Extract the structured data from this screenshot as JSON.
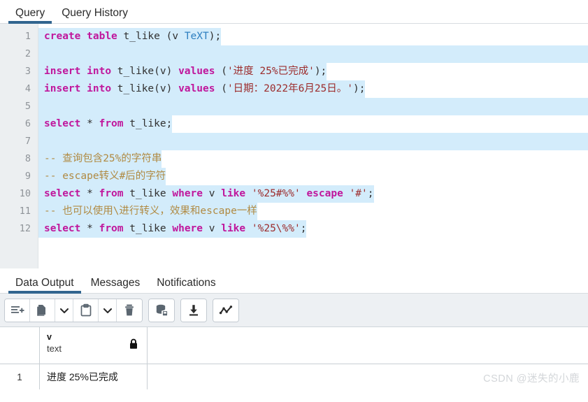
{
  "editor_tabs": [
    {
      "label": "Query",
      "active": true
    },
    {
      "label": "Query History",
      "active": false
    }
  ],
  "editor": {
    "accent_color": "#31658f",
    "selection_color": "#d3ecfb",
    "gutter_bg": "#eceff1",
    "lines": [
      {
        "no": "1",
        "tokens": [
          {
            "t": "create",
            "c": "kw"
          },
          {
            "t": " ",
            "c": "pl"
          },
          {
            "t": "table",
            "c": "kw"
          },
          {
            "t": " t_like (v ",
            "c": "pl"
          },
          {
            "t": "TeXT",
            "c": "typ"
          },
          {
            "t": ");",
            "c": "pl"
          }
        ]
      },
      {
        "no": "2",
        "tokens": []
      },
      {
        "no": "3",
        "tokens": [
          {
            "t": "insert",
            "c": "kw"
          },
          {
            "t": " ",
            "c": "pl"
          },
          {
            "t": "into",
            "c": "kw"
          },
          {
            "t": " t_like(v) ",
            "c": "pl"
          },
          {
            "t": "values",
            "c": "kw"
          },
          {
            "t": " (",
            "c": "pl"
          },
          {
            "t": "'进度 25%已完成'",
            "c": "str"
          },
          {
            "t": ");",
            "c": "pl"
          }
        ]
      },
      {
        "no": "4",
        "tokens": [
          {
            "t": "insert",
            "c": "kw"
          },
          {
            "t": " ",
            "c": "pl"
          },
          {
            "t": "into",
            "c": "kw"
          },
          {
            "t": " t_like(v) ",
            "c": "pl"
          },
          {
            "t": "values",
            "c": "kw"
          },
          {
            "t": " (",
            "c": "pl"
          },
          {
            "t": "'日期：2022年6月25日。'",
            "c": "str"
          },
          {
            "t": ");",
            "c": "pl"
          }
        ]
      },
      {
        "no": "5",
        "tokens": []
      },
      {
        "no": "6",
        "tokens": [
          {
            "t": "select",
            "c": "kw"
          },
          {
            "t": " * ",
            "c": "pl"
          },
          {
            "t": "from",
            "c": "kw"
          },
          {
            "t": " t_like;",
            "c": "pl"
          }
        ]
      },
      {
        "no": "7",
        "tokens": []
      },
      {
        "no": "8",
        "tokens": [
          {
            "t": "-- 查询包含25%的字符串",
            "c": "cmt"
          }
        ]
      },
      {
        "no": "9",
        "tokens": [
          {
            "t": "-- escape转义#后的字符",
            "c": "cmt"
          }
        ]
      },
      {
        "no": "10",
        "tokens": [
          {
            "t": "select",
            "c": "kw"
          },
          {
            "t": " * ",
            "c": "pl"
          },
          {
            "t": "from",
            "c": "kw"
          },
          {
            "t": " t_like ",
            "c": "pl"
          },
          {
            "t": "where",
            "c": "kw"
          },
          {
            "t": " v ",
            "c": "pl"
          },
          {
            "t": "like",
            "c": "kw"
          },
          {
            "t": " ",
            "c": "pl"
          },
          {
            "t": "'%25#%%'",
            "c": "str"
          },
          {
            "t": " ",
            "c": "pl"
          },
          {
            "t": "escape",
            "c": "kw"
          },
          {
            "t": " ",
            "c": "pl"
          },
          {
            "t": "'#'",
            "c": "str"
          },
          {
            "t": ";",
            "c": "pl"
          }
        ]
      },
      {
        "no": "11",
        "tokens": [
          {
            "t": "-- 也可以使用\\进行转义，效果和escape一样",
            "c": "cmt"
          }
        ]
      },
      {
        "no": "12",
        "tokens": [
          {
            "t": "select",
            "c": "kw"
          },
          {
            "t": " * ",
            "c": "pl"
          },
          {
            "t": "from",
            "c": "kw"
          },
          {
            "t": " t_like ",
            "c": "pl"
          },
          {
            "t": "where",
            "c": "kw"
          },
          {
            "t": " v ",
            "c": "pl"
          },
          {
            "t": "like",
            "c": "kw"
          },
          {
            "t": " ",
            "c": "pl"
          },
          {
            "t": "'%25\\%%'",
            "c": "str"
          },
          {
            "t": ";",
            "c": "pl"
          }
        ]
      }
    ]
  },
  "panel_tabs": [
    {
      "label": "Data Output",
      "active": true
    },
    {
      "label": "Messages",
      "active": false
    },
    {
      "label": "Notifications",
      "active": false
    }
  ],
  "toolbar": {
    "groups": [
      {
        "buttons": [
          {
            "icon": "add-row-icon",
            "narrow": false
          },
          {
            "icon": "copy-icon",
            "narrow": false
          },
          {
            "icon": "chevron-down-icon",
            "narrow": true
          },
          {
            "icon": "paste-icon",
            "narrow": false
          },
          {
            "icon": "chevron-down-icon",
            "narrow": true
          },
          {
            "icon": "delete-trash-icon",
            "narrow": false
          }
        ]
      },
      {
        "buttons": [
          {
            "icon": "save-data-changes-icon",
            "narrow": false
          }
        ]
      },
      {
        "buttons": [
          {
            "icon": "download-icon",
            "narrow": false
          }
        ]
      },
      {
        "buttons": [
          {
            "icon": "graph-visualiser-icon",
            "narrow": false
          }
        ]
      }
    ]
  },
  "grid": {
    "row_number_header": "",
    "columns": [
      {
        "name": "v",
        "type": "text",
        "locked": true
      }
    ],
    "rows": [
      {
        "num": "1",
        "cells": [
          "进度 25%已完成"
        ]
      }
    ]
  },
  "watermark": "CSDN @迷失的小鹿"
}
